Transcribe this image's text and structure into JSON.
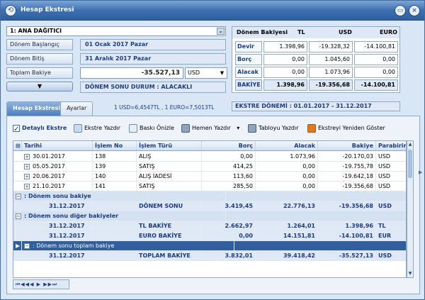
{
  "window": {
    "title": "Hesap Ekstresi"
  },
  "account": {
    "name": "1: ANA DAĞITICI"
  },
  "fields": {
    "start_label": "Dönem Başlangıç",
    "start_value": "01 Ocak 2017 Pazar",
    "end_label": "Dönem Bitiş",
    "end_value": "31 Aralık 2017 Pazar",
    "total_label": "Toplam Bakiye",
    "total_value": "-35.527,13",
    "currency": "USD",
    "expand_glyph": "▼",
    "status": "DÖNEM SONU DURUM : ALACAKLI"
  },
  "balance": {
    "title": "Dönem Bakiyesi",
    "headers": [
      "TL",
      "USD",
      "EURO"
    ],
    "rows": [
      {
        "label": "Devir",
        "tl": "1.398,96",
        "usd": "-19.328,32",
        "euro": "-14.100,81"
      },
      {
        "label": "Borç",
        "tl": "0,00",
        "usd": "1.045,60",
        "euro": "0,00"
      },
      {
        "label": "Alacak",
        "tl": "0,00",
        "usd": "1.073,96",
        "euro": "0,00"
      },
      {
        "label": "BAKİYE",
        "tl": "1.398,96",
        "usd": "-19.356,68",
        "euro": "-14.100,81"
      }
    ]
  },
  "tabs": [
    {
      "label": "Hesap Ekstresi"
    },
    {
      "label": "Ayarlar"
    }
  ],
  "rates": "1 USD=6,4547TL , 1 EURO=7,5013TL",
  "period": "EKSTRE DÖNEMİ : 01.01.2017 - 31.12.2017",
  "toolbar": {
    "detail": "Detaylı Ekstre",
    "print": "Ekstre Yazdır",
    "preview": "Baskı Önizle",
    "quick_print": "Hemen Yazdır",
    "table_print": "Tabloyu Yazdır",
    "recalc": "Ekstreyi Yeniden Göster"
  },
  "grid": {
    "headers": [
      "Tarihi",
      "İşlem No",
      "İşlem Türü",
      "Borç",
      "Alacak",
      "Bakiye",
      "Parabirimi"
    ],
    "rows": [
      {
        "date": "30.01.2017",
        "no": "138",
        "type": "ALIŞ",
        "debit": "0,00",
        "credit": "1.073,96",
        "balance": "-20.170,03",
        "cur": "USD"
      },
      {
        "date": "05.05.2017",
        "no": "139",
        "type": "SATIŞ",
        "debit": "414,25",
        "credit": "0,00",
        "balance": "-19.755,78",
        "cur": "USD"
      },
      {
        "date": "20.06.2017",
        "no": "140",
        "type": "ALIŞ İADESİ",
        "debit": "113,60",
        "credit": "0,00",
        "balance": "-19.642,18",
        "cur": "USD"
      },
      {
        "date": "21.10.2017",
        "no": "141",
        "type": "SATIŞ",
        "debit": "285,50",
        "credit": "0,00",
        "balance": "-19.356,68",
        "cur": "USD"
      }
    ],
    "group1": ": Dönem sonu bakiye",
    "sum1": {
      "date": "31.12.2017",
      "type": "DÖNEM SONU",
      "debit": "3.419,45",
      "credit": "22.776,13",
      "balance": "-19.356,68",
      "cur": "USD"
    },
    "group2": ": Dönem sonu diğer bakiyeler",
    "sum2a": {
      "date": "31.12.2017",
      "type": "TL BAKİYE",
      "debit": "2.662,97",
      "credit": "1.264,01",
      "balance": "1.398,96",
      "cur": "TL"
    },
    "sum2b": {
      "date": "31.12.2017",
      "type": "EURO BAKİYE",
      "debit": "0,00",
      "credit": "14.151,81",
      "balance": "-14.100,81",
      "cur": "EUR"
    },
    "group3": ": Dönem sonu toplam bakiye",
    "sum3": {
      "date": "31.12.2017",
      "type": "TOPLAM BAKİYE",
      "debit": "3.832,01",
      "credit": "39.418,42",
      "balance": "-35.527,13",
      "cur": "USD"
    }
  },
  "nav": "⏮◀◀◀ ▶ ▶▶⏭"
}
